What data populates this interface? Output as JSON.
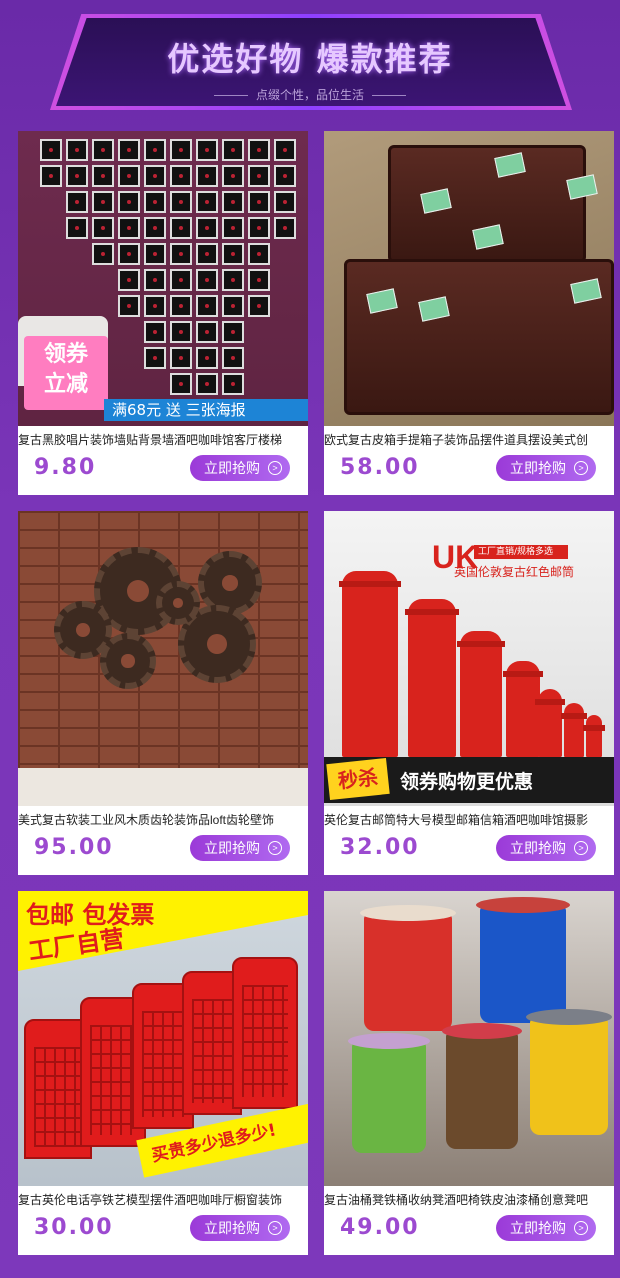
{
  "header": {
    "title": "优选好物 爆款推荐",
    "subtitle": "点缀个性，品位生活"
  },
  "buy_label": "立即抢购",
  "products": [
    {
      "name": "复古黑胶唱片装饰墙贴背景墙酒吧咖啡馆客厅楼梯",
      "price": "9.80",
      "promo_badge": "领券\n立减",
      "promo_bar": "满68元 送 三张海报"
    },
    {
      "name": "欧式复古皮箱手提箱子装饰品摆件道具摆设美式创",
      "price": "58.00"
    },
    {
      "name": "美式复古软装工业风木质齿轮装饰品loft齿轮壁饰",
      "price": "95.00"
    },
    {
      "name": "英伦复古邮筒特大号模型邮箱信箱酒吧咖啡馆摄影",
      "price": "32.00",
      "logo": "UK",
      "tag": "工厂直销/规格多选",
      "subtitle": "英国伦敦复古红色邮筒",
      "badge": "秒杀",
      "banner": "领券购物更优惠"
    },
    {
      "name": "复古英伦电话亭铁艺模型摆件酒吧咖啡厅橱窗装饰",
      "price": "30.00",
      "banner_top": "包邮 包发票",
      "banner_mid": "工厂自营",
      "banner_bottom": "买贵多少退多少!"
    },
    {
      "name": "复古油桶凳铁桶收纳凳酒吧椅铁皮油漆桶创意凳吧",
      "price": "49.00"
    }
  ]
}
